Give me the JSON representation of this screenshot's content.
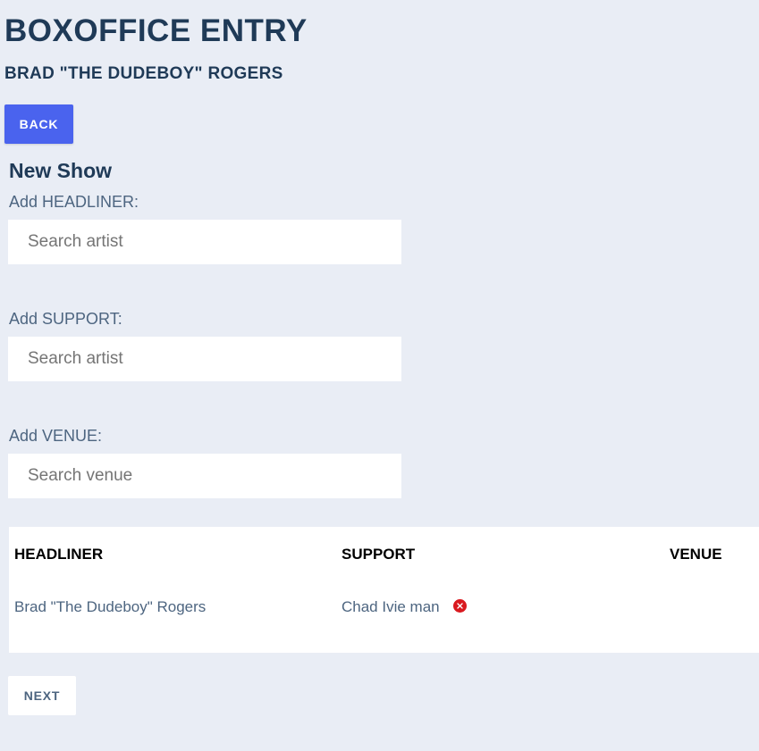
{
  "header": {
    "title": "BOXOFFICE ENTRY",
    "user_name": "BRAD \"THE DUDEBOY\" ROGERS",
    "back_label": "BACK"
  },
  "form": {
    "section_title": "New Show",
    "headliner": {
      "label": "Add HEADLINER:",
      "placeholder": "Search artist",
      "value": ""
    },
    "support": {
      "label": "Add SUPPORT:",
      "placeholder": "Search artist",
      "value": ""
    },
    "venue": {
      "label": "Add VENUE:",
      "placeholder": "Search venue",
      "value": ""
    }
  },
  "table": {
    "columns": [
      "HEADLINER",
      "SUPPORT",
      "VENUE"
    ],
    "row": {
      "headliner": "Brad \"The Dudeboy\" Rogers",
      "support": "Chad Ivie man",
      "venue": ""
    },
    "remove_icon": "close-circle-icon",
    "remove_color": "#d9191f"
  },
  "footer": {
    "next_label": "NEXT"
  },
  "colors": {
    "background": "#e9edf5",
    "title": "#1f3a57",
    "accent": "#4a63ee",
    "label": "#4d6580"
  }
}
